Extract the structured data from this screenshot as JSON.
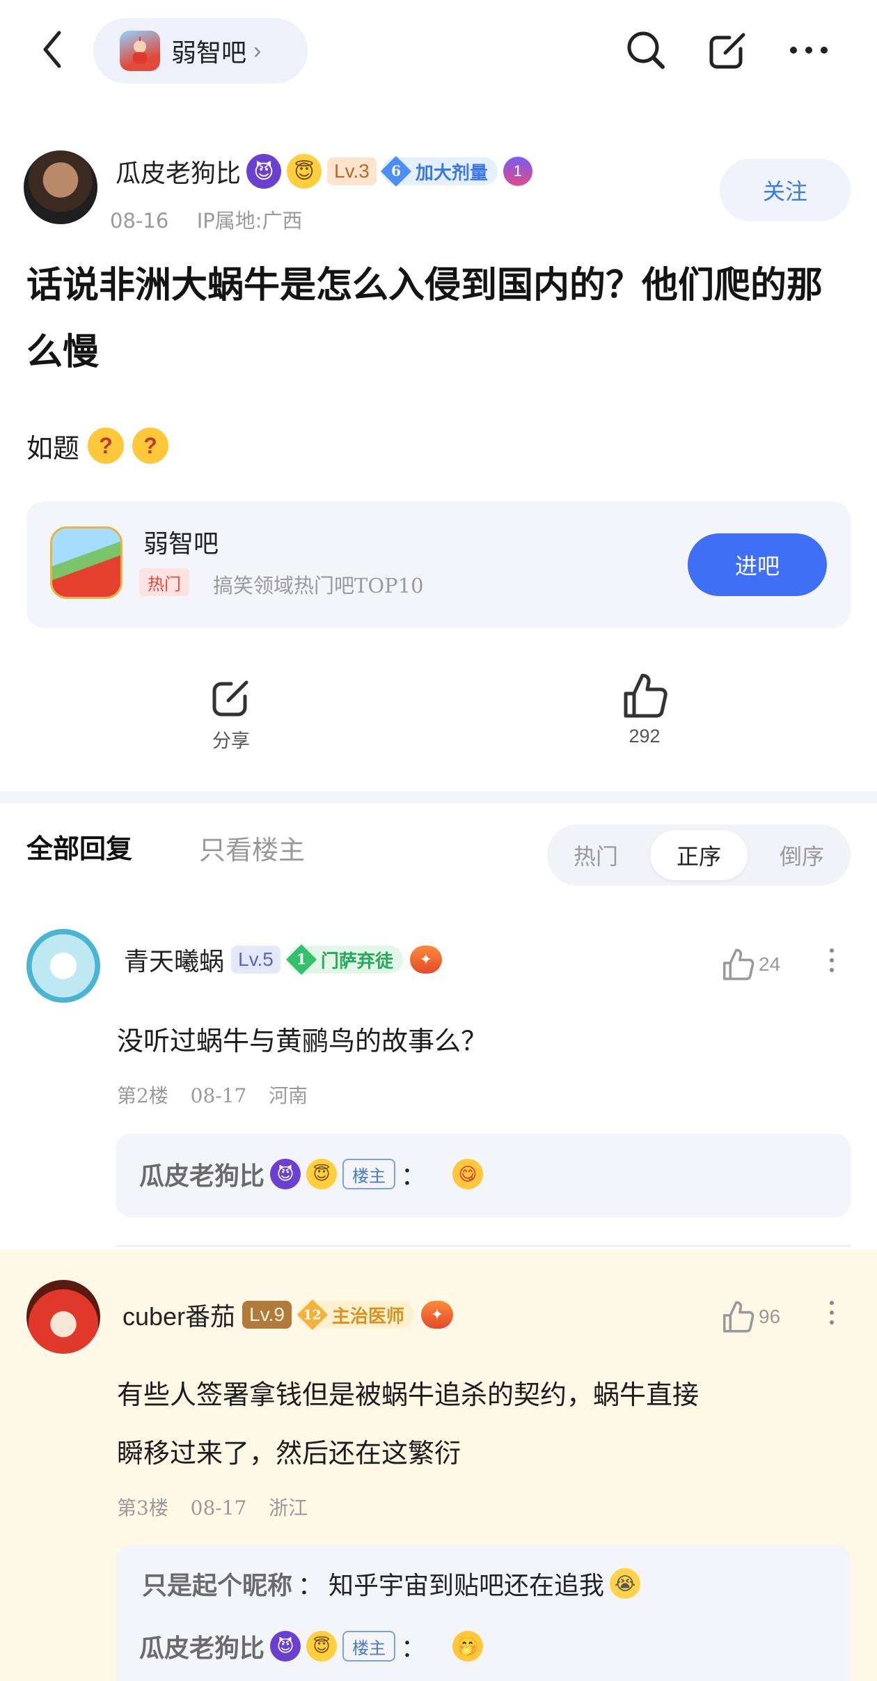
{
  "topbar": {
    "forum_name": "弱智吧",
    "icons": [
      "back-icon",
      "search-icon",
      "edit-share-icon",
      "more-icon"
    ]
  },
  "post": {
    "author": {
      "name": "瓜皮老狗比",
      "level": "Lv.3",
      "title_num": "6",
      "title_text": "加大剂量",
      "medal_num": "1",
      "date": "08-16",
      "ip": "IP属地:广西"
    },
    "follow_label": "关注",
    "title": "话说非洲大蜗牛是怎么入侵到国内的？他们爬的那么慢",
    "body": "如题"
  },
  "forum_card": {
    "name": "弱智吧",
    "hot_tag": "热门",
    "desc": "搞笑领域热门吧TOP10",
    "enter_label": "进吧"
  },
  "actions": {
    "share_label": "分享",
    "like_count": "292"
  },
  "reply_tabs": {
    "all": "全部回复",
    "owner_only": "只看楼主",
    "sort": [
      "热门",
      "正序",
      "倒序"
    ],
    "sort_active": "正序"
  },
  "replies": [
    {
      "name": "青天曦蜗",
      "level": "Lv.5",
      "badge_num": "1",
      "badge_text": "门萨弃徒",
      "likes": "24",
      "text": "没听过蜗牛与黄鹂鸟的故事么？",
      "floor": "第2楼",
      "date": "08-17",
      "location": "河南",
      "sub": [
        {
          "name": "瓜皮老狗比",
          "tag": "楼主",
          "colon": "：",
          "text": ""
        }
      ]
    },
    {
      "name": "cuber番茄",
      "level": "Lv.9",
      "badge_num": "12",
      "badge_text": "主治医师",
      "likes": "96",
      "text_line1": "有些人签署拿钱但是被蜗牛追杀的契约，蜗牛直接",
      "text_line2": "瞬移过来了，然后还在这繁衍",
      "floor": "第3楼",
      "date": "08-17",
      "location": "浙江",
      "sub": [
        {
          "name": "只是起个昵称",
          "colon": "：",
          "text": "知乎宇宙到贴吧还在追我"
        },
        {
          "name": "瓜皮老狗比",
          "tag": "楼主",
          "colon": "："
        }
      ]
    }
  ]
}
